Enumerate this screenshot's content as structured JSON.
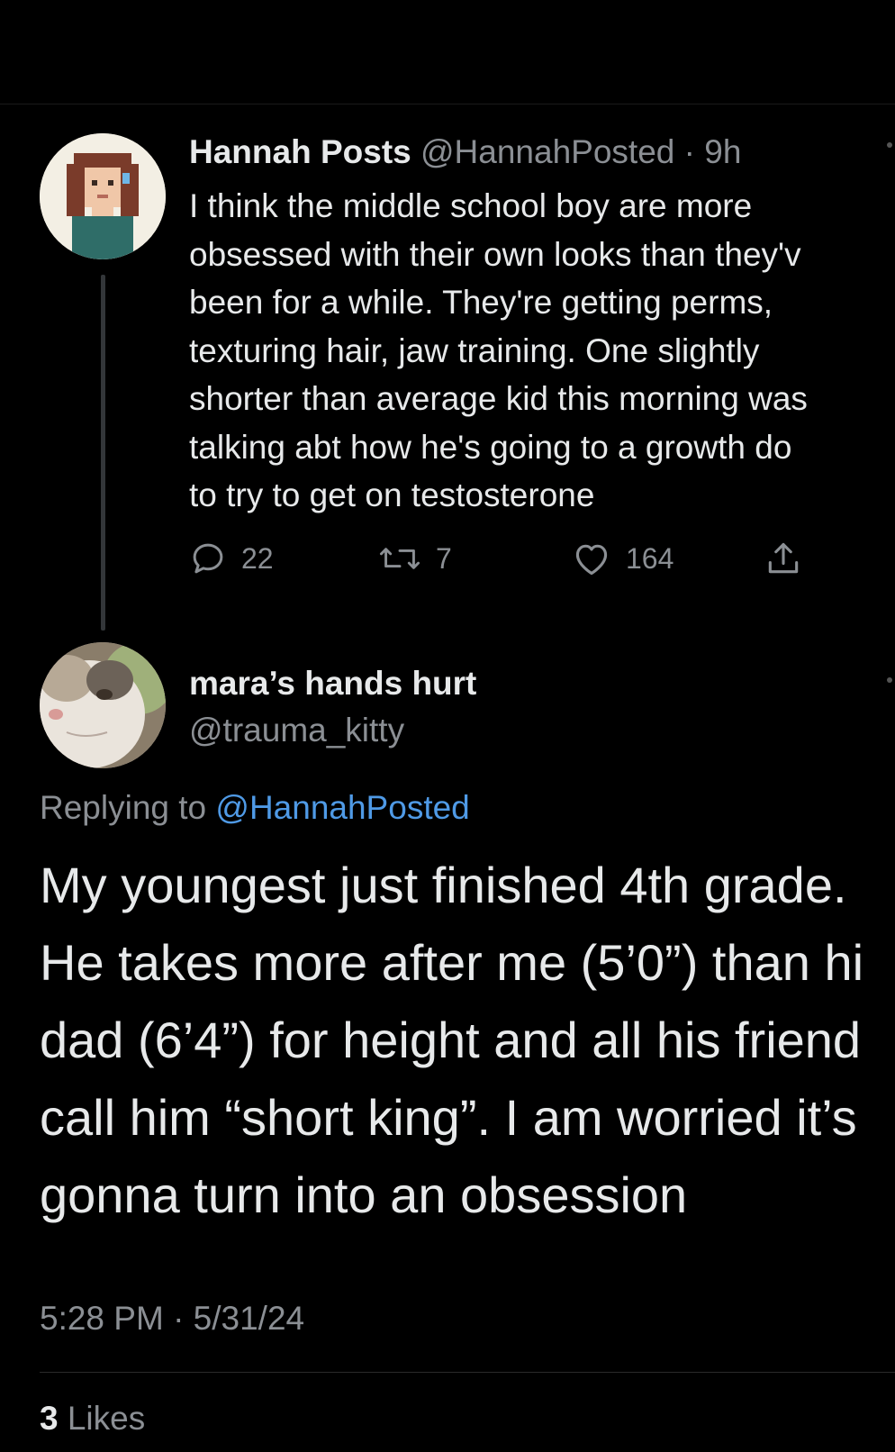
{
  "parent_tweet": {
    "display_name": "Hannah Posts",
    "handle": "@HannahPosted",
    "separator": "·",
    "time": "9h",
    "lines": [
      "I think the middle school boy are more",
      "obsessed with their own looks than they'v",
      "been for a while. They're getting perms,",
      "texturing hair, jaw training. One slightly",
      "shorter than average kid this morning was",
      "talking abt how he's going to a growth do",
      "to try to get on testosterone"
    ],
    "actions": {
      "reply_count": "22",
      "retweet_count": "7",
      "like_count": "164"
    }
  },
  "reply_tweet": {
    "display_name": "mara’s hands hurt",
    "handle": "@trauma_kitty",
    "replying_prefix": "Replying to ",
    "replying_to": "@HannahPosted",
    "lines": [
      "My youngest just finished 4th grade.",
      "He takes more after me (5’0”) than hi",
      "dad (6’4”) for height and all his friend",
      "call him “short king”. I am worried it’s",
      "gonna turn into an obsession"
    ],
    "timestamp": "5:28 PM · 5/31/24",
    "likes_count": "3",
    "likes_label": " Likes"
  },
  "colors": {
    "background": "#000000",
    "primary_text": "#e7e9ea",
    "secondary_text": "#8b8f94",
    "link": "#4f9ae6"
  }
}
